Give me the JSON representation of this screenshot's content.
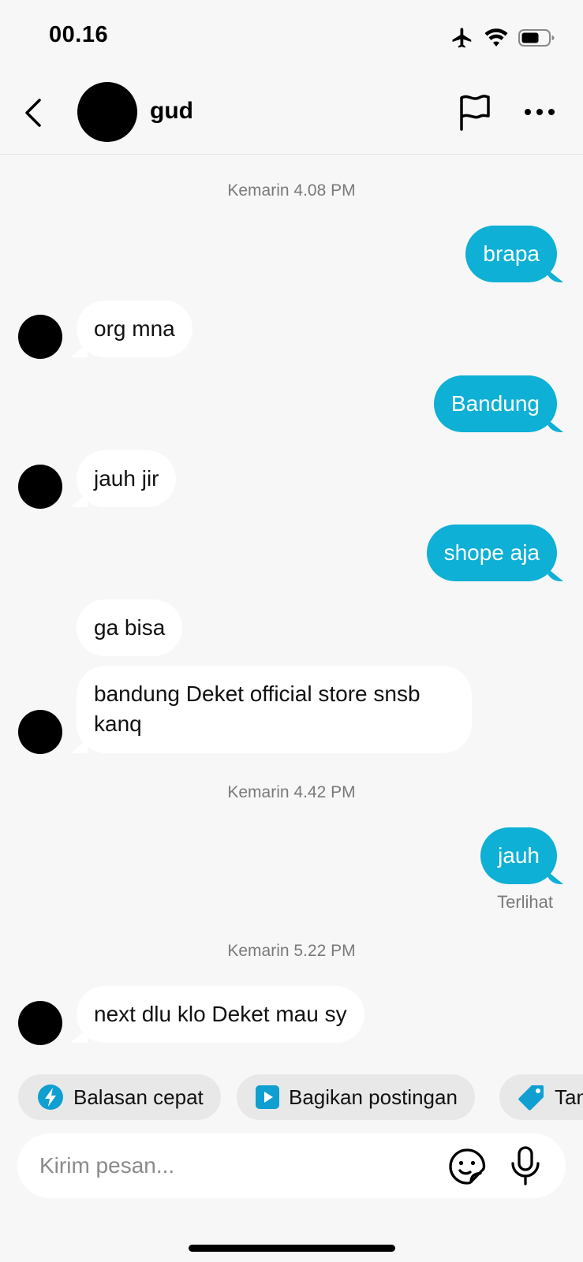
{
  "status_bar": {
    "time": "00.16",
    "icons": [
      "airplane-icon",
      "wifi-icon",
      "battery-icon"
    ]
  },
  "header": {
    "contact_name": "gud"
  },
  "conversation": {
    "timestamps": [
      "Kemarin 4.08 PM",
      "Kemarin 4.42 PM",
      "Kemarin 5.22 PM"
    ],
    "messages": [
      {
        "sender": "me",
        "text": "brapa"
      },
      {
        "sender": "them",
        "text": "org mna"
      },
      {
        "sender": "me",
        "text": "Bandung"
      },
      {
        "sender": "them",
        "text": "jauh jir"
      },
      {
        "sender": "me",
        "text": "shope aja"
      },
      {
        "sender": "them",
        "text": "ga bisa"
      },
      {
        "sender": "them",
        "text": "bandung Deket official store snsb kanq"
      },
      {
        "sender": "me",
        "text": "jauh"
      },
      {
        "sender": "them",
        "text": "next dlu klo Deket mau sy"
      }
    ],
    "seen_label": "Terlihat"
  },
  "quick_actions": [
    {
      "label": "Balasan cepat",
      "icon": "lightning-icon"
    },
    {
      "label": "Bagikan postingan",
      "icon": "play-icon"
    },
    {
      "label": "Tan",
      "icon": "tag-icon"
    }
  ],
  "composer": {
    "placeholder": "Kirim pesan...",
    "icons": [
      "sticker-icon",
      "microphone-icon"
    ]
  },
  "colors": {
    "outgoing_bubble": "#0eb0d5",
    "incoming_bubble": "#ffffff",
    "background": "#f7f7f7"
  }
}
